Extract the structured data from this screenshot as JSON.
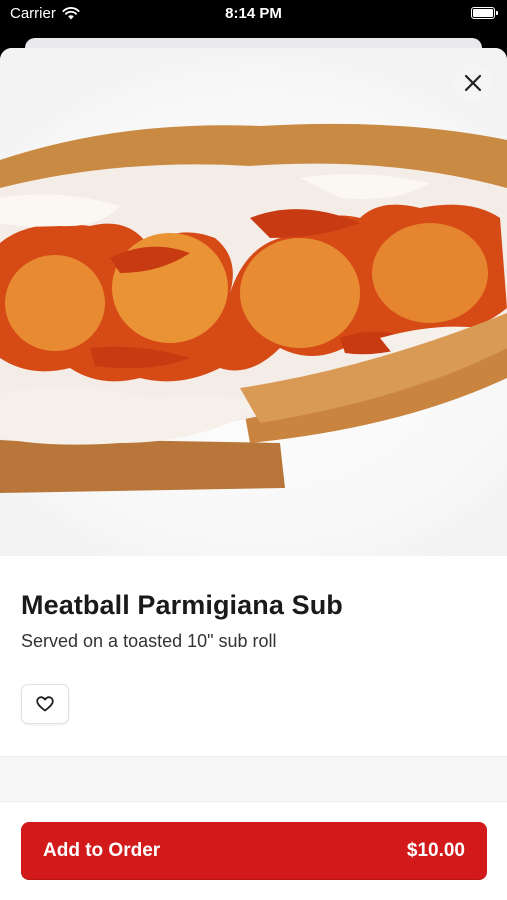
{
  "status_bar": {
    "carrier": "Carrier",
    "time": "8:14 PM"
  },
  "item": {
    "name": "Meatball Parmigiana Sub",
    "description": "Served on a toasted 10\" sub roll",
    "image_icon": "photo-of-meatball-parmigiana-sub"
  },
  "actions": {
    "close_icon": "close-icon",
    "favorite_icon": "heart-outline-icon",
    "add_to_order_label": "Add to Order",
    "price": "$10.00"
  },
  "colors": {
    "accent": "#d21a1a",
    "text_primary": "#1a1a1a",
    "text_secondary": "#333333"
  }
}
